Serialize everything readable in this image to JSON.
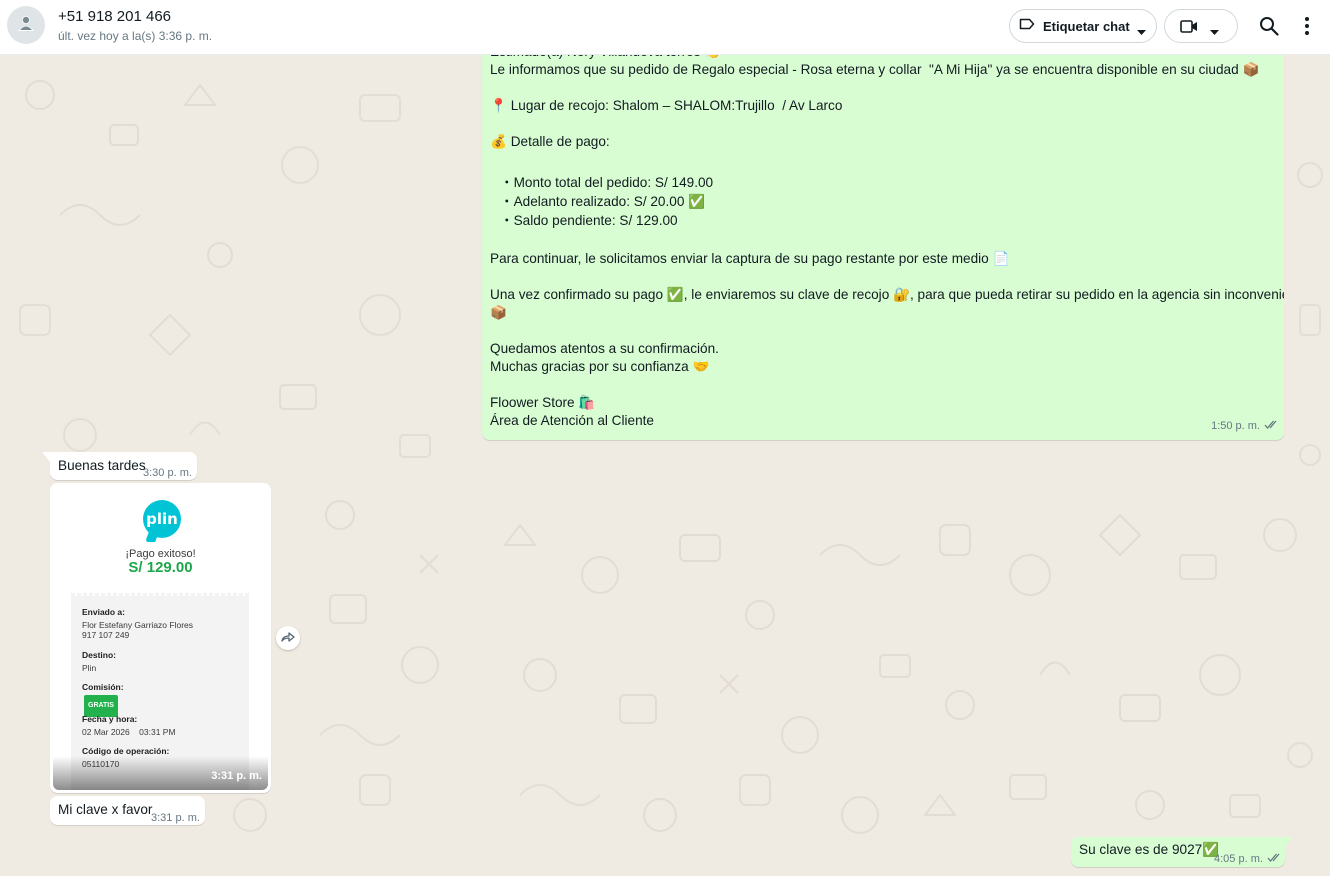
{
  "header": {
    "contact_name": "+51 918 201 466",
    "contact_status": "últ. vez hoy a la(s) 3:36 p. m.",
    "tag_button_label": "Etiquetar chat",
    "icons": [
      "person-icon",
      "label-icon",
      "chevron-down-icon",
      "video-camera-icon",
      "search-icon",
      "more-vertical-icon"
    ]
  },
  "messages": {
    "big": {
      "line_top": "Estimado(a) Nery Villanueva torres 👏",
      "line_info": "Le informamos que su pedido de Regalo especial - Rosa eterna y collar  \"A Mi Hija\" ya se encuentra disponible en su ciudad 📦",
      "line_pickup": "📍 Lugar de recojo: Shalom – SHALOM:Trujillo  / Av Larco",
      "line_detail": "💰 Detalle de pago:",
      "bullet_total": "・Monto total del pedido: S/ 149.00",
      "bullet_advance": "・Adelanto realizado: S/ 20.00 ✅",
      "bullet_balance": "・Saldo pendiente: S/ 129.00",
      "line_continue": "Para continuar, le solicitamos enviar la captura de su pago restante por este medio 📄",
      "line_confirm_1": "Una vez confirmado su pago ✅, le enviaremos su clave de recojo 🔐, para que pueda retirar su pedido en la agencia sin inconvenientes",
      "line_confirm_2": "📦",
      "line_attentive": "Quedamos atentos a su confirmación.",
      "line_thanks": "Muchas gracias por su confianza 🤝",
      "line_store": "Floower Store 🛍️",
      "line_area": "Área de Atención al Cliente",
      "time": "1:50 p. m."
    },
    "tardes": {
      "text": "Buenas tardes",
      "time": "3:30 p. m."
    },
    "receipt_image": {
      "brand": "plin",
      "status": "¡Pago exitoso!",
      "amount": "S/ 129.00",
      "sent_to_label": "Enviado a:",
      "sent_to_name": "Flor Estefany Garriazo Flores",
      "sent_to_phone": "917 107 249",
      "destination_label": "Destino:",
      "destination_value": "Plin",
      "fee_label": "Comisión:",
      "fee_value": "GRATIS",
      "datetime_label": "Fecha y hora:",
      "datetime_value": "02 Mar 2026    03:31 PM",
      "operation_label": "Código de operación:",
      "operation_value": "05110170",
      "time": "3:31 p. m."
    },
    "clave": {
      "text": "Mi clave x favor",
      "time": "3:31 p. m."
    },
    "su_clave": {
      "text": "Su clave es de 9027✅",
      "time": "4:05 p. m."
    }
  },
  "colors": {
    "outgoing_bubble": "#d9fdd3",
    "incoming_bubble": "#ffffff",
    "chat_background": "#efeae2",
    "read_ticks": "#667781",
    "plin_brand": "#00c3d6",
    "amount_green": "#1ea64a"
  }
}
